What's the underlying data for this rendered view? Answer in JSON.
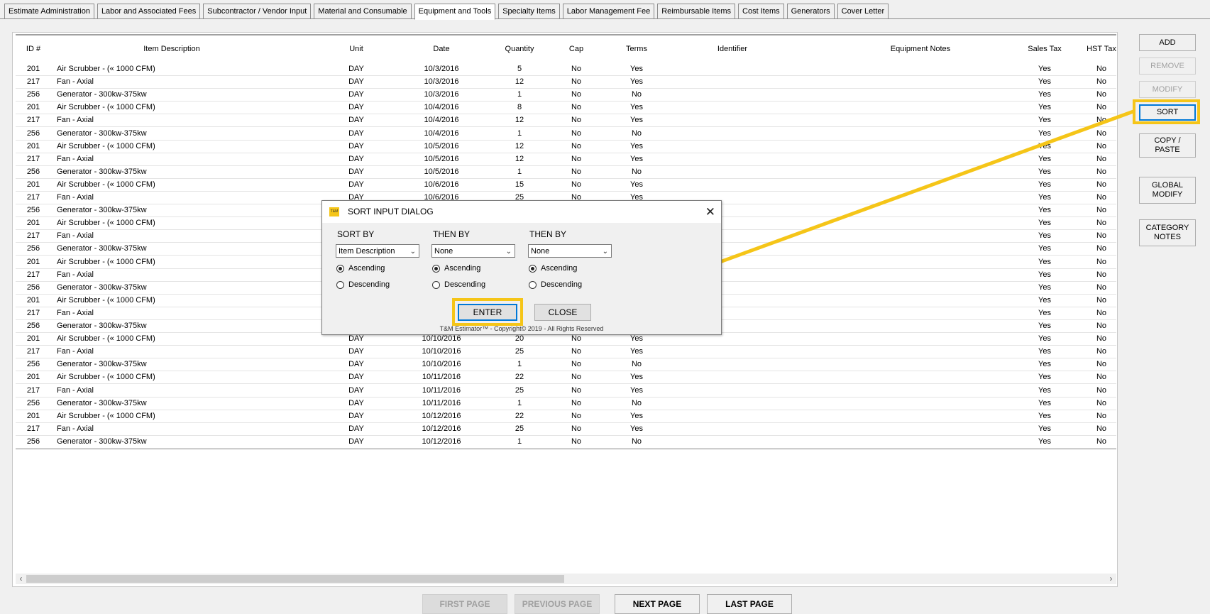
{
  "tabs": [
    {
      "label": "Estimate Administration"
    },
    {
      "label": "Labor and Associated Fees"
    },
    {
      "label": "Subcontractor / Vendor Input"
    },
    {
      "label": "Material and Consumable"
    },
    {
      "label": "Equipment and Tools",
      "active": true
    },
    {
      "label": "Specialty Items"
    },
    {
      "label": "Labor Management Fee"
    },
    {
      "label": "Reimbursable Items"
    },
    {
      "label": "Cost Items"
    },
    {
      "label": "Generators"
    },
    {
      "label": "Cover Letter"
    }
  ],
  "grid": {
    "columns": [
      "ID #",
      "Item Description",
      "Unit",
      "Date",
      "Quantity",
      "Cap",
      "Terms",
      "Identifier",
      "Equipment Notes",
      "Sales Tax",
      "HST Tax"
    ],
    "rows": [
      [
        "201",
        "Air Scrubber - (« 1000 CFM)",
        "DAY",
        "10/3/2016",
        "5",
        "No",
        "Yes",
        "",
        "",
        "Yes",
        "No"
      ],
      [
        "217",
        "Fan - Axial",
        "DAY",
        "10/3/2016",
        "12",
        "No",
        "Yes",
        "",
        "",
        "Yes",
        "No"
      ],
      [
        "256",
        "Generator - 300kw-375kw",
        "DAY",
        "10/3/2016",
        "1",
        "No",
        "No",
        "",
        "",
        "Yes",
        "No"
      ],
      [
        "201",
        "Air Scrubber - (« 1000 CFM)",
        "DAY",
        "10/4/2016",
        "8",
        "No",
        "Yes",
        "",
        "",
        "Yes",
        "No"
      ],
      [
        "217",
        "Fan - Axial",
        "DAY",
        "10/4/2016",
        "12",
        "No",
        "Yes",
        "",
        "",
        "Yes",
        "No"
      ],
      [
        "256",
        "Generator - 300kw-375kw",
        "DAY",
        "10/4/2016",
        "1",
        "No",
        "No",
        "",
        "",
        "Yes",
        "No"
      ],
      [
        "201",
        "Air Scrubber - (« 1000 CFM)",
        "DAY",
        "10/5/2016",
        "12",
        "No",
        "Yes",
        "",
        "",
        "Yes",
        "No"
      ],
      [
        "217",
        "Fan - Axial",
        "DAY",
        "10/5/2016",
        "12",
        "No",
        "Yes",
        "",
        "",
        "Yes",
        "No"
      ],
      [
        "256",
        "Generator - 300kw-375kw",
        "DAY",
        "10/5/2016",
        "1",
        "No",
        "No",
        "",
        "",
        "Yes",
        "No"
      ],
      [
        "201",
        "Air Scrubber - (« 1000 CFM)",
        "DAY",
        "10/6/2016",
        "15",
        "No",
        "Yes",
        "",
        "",
        "Yes",
        "No"
      ],
      [
        "217",
        "Fan - Axial",
        "DAY",
        "10/6/2016",
        "25",
        "No",
        "Yes",
        "",
        "",
        "Yes",
        "No"
      ],
      [
        "256",
        "Generator - 300kw-375kw",
        "",
        "",
        "",
        "",
        "",
        "",
        "",
        "Yes",
        "No"
      ],
      [
        "201",
        "Air Scrubber - (« 1000 CFM)",
        "",
        "",
        "",
        "",
        "",
        "",
        "",
        "Yes",
        "No"
      ],
      [
        "217",
        "Fan - Axial",
        "",
        "",
        "",
        "",
        "",
        "",
        "",
        "Yes",
        "No"
      ],
      [
        "256",
        "Generator - 300kw-375kw",
        "",
        "",
        "",
        "",
        "",
        "",
        "",
        "Yes",
        "No"
      ],
      [
        "201",
        "Air Scrubber - (« 1000 CFM)",
        "",
        "",
        "",
        "",
        "",
        "",
        "",
        "Yes",
        "No"
      ],
      [
        "217",
        "Fan - Axial",
        "",
        "",
        "",
        "",
        "",
        "",
        "",
        "Yes",
        "No"
      ],
      [
        "256",
        "Generator - 300kw-375kw",
        "",
        "",
        "",
        "",
        "",
        "",
        "",
        "Yes",
        "No"
      ],
      [
        "201",
        "Air Scrubber - (« 1000 CFM)",
        "",
        "",
        "",
        "",
        "",
        "",
        "",
        "Yes",
        "No"
      ],
      [
        "217",
        "Fan - Axial",
        "",
        "",
        "",
        "",
        "",
        "",
        "",
        "Yes",
        "No"
      ],
      [
        "256",
        "Generator - 300kw-375kw",
        "",
        "",
        "",
        "",
        "",
        "",
        "",
        "Yes",
        "No"
      ],
      [
        "201",
        "Air Scrubber - (« 1000 CFM)",
        "DAY",
        "10/10/2016",
        "20",
        "No",
        "Yes",
        "",
        "",
        "Yes",
        "No"
      ],
      [
        "217",
        "Fan - Axial",
        "DAY",
        "10/10/2016",
        "25",
        "No",
        "Yes",
        "",
        "",
        "Yes",
        "No"
      ],
      [
        "256",
        "Generator - 300kw-375kw",
        "DAY",
        "10/10/2016",
        "1",
        "No",
        "No",
        "",
        "",
        "Yes",
        "No"
      ],
      [
        "201",
        "Air Scrubber - (« 1000 CFM)",
        "DAY",
        "10/11/2016",
        "22",
        "No",
        "Yes",
        "",
        "",
        "Yes",
        "No"
      ],
      [
        "217",
        "Fan - Axial",
        "DAY",
        "10/11/2016",
        "25",
        "No",
        "Yes",
        "",
        "",
        "Yes",
        "No"
      ],
      [
        "256",
        "Generator - 300kw-375kw",
        "DAY",
        "10/11/2016",
        "1",
        "No",
        "No",
        "",
        "",
        "Yes",
        "No"
      ],
      [
        "201",
        "Air Scrubber - (« 1000 CFM)",
        "DAY",
        "10/12/2016",
        "22",
        "No",
        "Yes",
        "",
        "",
        "Yes",
        "No"
      ],
      [
        "217",
        "Fan - Axial",
        "DAY",
        "10/12/2016",
        "25",
        "No",
        "Yes",
        "",
        "",
        "Yes",
        "No"
      ],
      [
        "256",
        "Generator - 300kw-375kw",
        "DAY",
        "10/12/2016",
        "1",
        "No",
        "No",
        "",
        "",
        "Yes",
        "No"
      ]
    ]
  },
  "side_buttons": {
    "add": "ADD",
    "remove": "REMOVE",
    "modify": "MODIFY",
    "sort": "SORT",
    "copy_paste_1": "COPY /",
    "copy_paste_2": "PASTE",
    "global_modify_1": "GLOBAL",
    "global_modify_2": "MODIFY",
    "category_notes_1": "CATEGORY",
    "category_notes_2": "NOTES"
  },
  "paging": {
    "first": "FIRST PAGE",
    "previous": "PREVIOUS PAGE",
    "next": "NEXT PAGE",
    "last": "LAST PAGE"
  },
  "dialog": {
    "logo": "T&M",
    "title": "SORT INPUT DIALOG",
    "close_glyph": "✕",
    "sort_by_label": "SORT BY",
    "then_by_label_1": "THEN BY",
    "then_by_label_2": "THEN BY",
    "sort_by_value": "Item Description",
    "then_by_value_1": "None",
    "then_by_value_2": "None",
    "ascending": "Ascending",
    "descending": "Descending",
    "enter": "ENTER",
    "close": "CLOSE",
    "copyright": "T&M Estimator™ - Copyright© 2019 - All Rights Reserved"
  },
  "colors": {
    "highlight": "#f5c518",
    "focus": "#0078d7"
  },
  "icons": {
    "scroll_left": "‹",
    "scroll_right": "›",
    "chevron_down": "⌄"
  }
}
